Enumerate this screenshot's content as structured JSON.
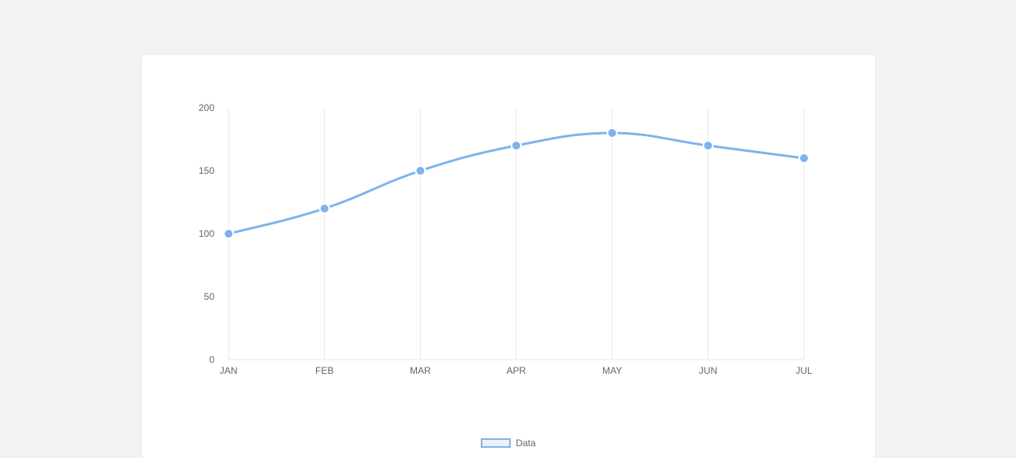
{
  "chart_data": {
    "type": "line",
    "categories": [
      "JAN",
      "FEB",
      "MAR",
      "APR",
      "MAY",
      "JUN",
      "JUL"
    ],
    "values": [
      100,
      120,
      150,
      170,
      180,
      170,
      160
    ],
    "title": "",
    "xlabel": "",
    "ylabel": "",
    "ylim": [
      0,
      200
    ],
    "y_ticks": [
      0,
      50,
      100,
      150,
      200
    ],
    "series": [
      {
        "name": "Data",
        "values": [
          100,
          120,
          150,
          170,
          180,
          170,
          160
        ]
      }
    ],
    "legend_position": "bottom",
    "grid": true,
    "line_color": "#7eb3ed",
    "point_radius": 6
  },
  "legend": {
    "label": "Data"
  }
}
